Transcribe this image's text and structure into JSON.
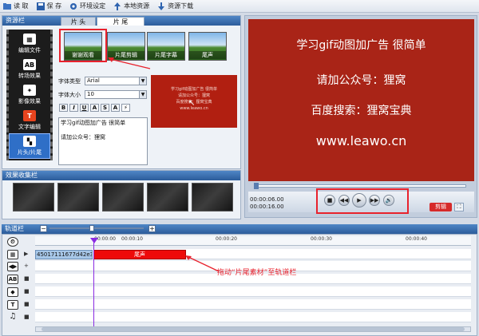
{
  "toolbar": {
    "items": [
      {
        "label": "读 取",
        "icon": "folder-open-icon"
      },
      {
        "label": "保 存",
        "icon": "save-icon"
      },
      {
        "label": "环境设定",
        "icon": "gear-icon"
      },
      {
        "label": "本地资源",
        "icon": "upload-icon"
      },
      {
        "label": "资源下载",
        "icon": "download-icon"
      }
    ]
  },
  "resource_panel": {
    "title": "资源栏",
    "tabs": [
      "片 头",
      "片 尾"
    ],
    "active_tab": 1,
    "sidebar": [
      {
        "label": "编辑文件",
        "glyph": "▦"
      },
      {
        "label": "转场效果",
        "glyph": "AB"
      },
      {
        "label": "影像效果",
        "glyph": "✦"
      },
      {
        "label": "文字编辑",
        "glyph": "T"
      },
      {
        "label": "片头/片尾",
        "glyph": "▚"
      }
    ],
    "thumbnails": [
      "谢谢观看",
      "片尾剪辑",
      "片尾字幕",
      "尾声"
    ],
    "font_type_label": "字体类型",
    "font_type_value": "Arial",
    "font_size_label": "字体大小",
    "font_size_value": "10",
    "format_buttons": [
      "B",
      "I",
      "U",
      "A",
      "S",
      "A"
    ],
    "text_lines": [
      "学习gif动图加广告 很简单",
      "",
      "请加公众号：狸窝"
    ],
    "mini_preview_lines": [
      "学习gif动图加广告 很简单",
      "请加公众号：狸窝",
      "百度搜索：狸窝宝典",
      "www.leawo.cn"
    ]
  },
  "effects_panel": {
    "title": "效果收集栏"
  },
  "preview": {
    "lines": [
      "学习gif动图加广告 很简单",
      "请加公众号：狸窝",
      "百度搜索：狸窝宝典",
      "www.leawo.cn"
    ],
    "time_current": "00:00:06.00",
    "time_total": "00:00:16.00",
    "clip_button": "剪辑",
    "controls": [
      "■",
      "◀◀",
      "▶",
      "▶▶",
      "🔊"
    ]
  },
  "timeline": {
    "title": "轨道栏",
    "ticks": [
      "00:00:00",
      "00:00:10",
      "00:00:20",
      "00:00:30",
      "00:00:40"
    ],
    "video_clip_label": "45017111677d42e35",
    "tail_clip_label": "尾声",
    "annotation": "拖动“片尾素材”至轨道栏",
    "track_icons": [
      "⏲",
      "▦",
      "◀▶",
      "AB",
      "◆",
      "T",
      "♫"
    ],
    "row_mini": [
      "▶",
      "+",
      "■",
      "■",
      "■",
      "■"
    ]
  },
  "colors": {
    "accent_red": "#e8222d",
    "preview_bg": "#a92417",
    "panel_header": "#2c5c9b",
    "clip_red": "#ee0a0a"
  }
}
